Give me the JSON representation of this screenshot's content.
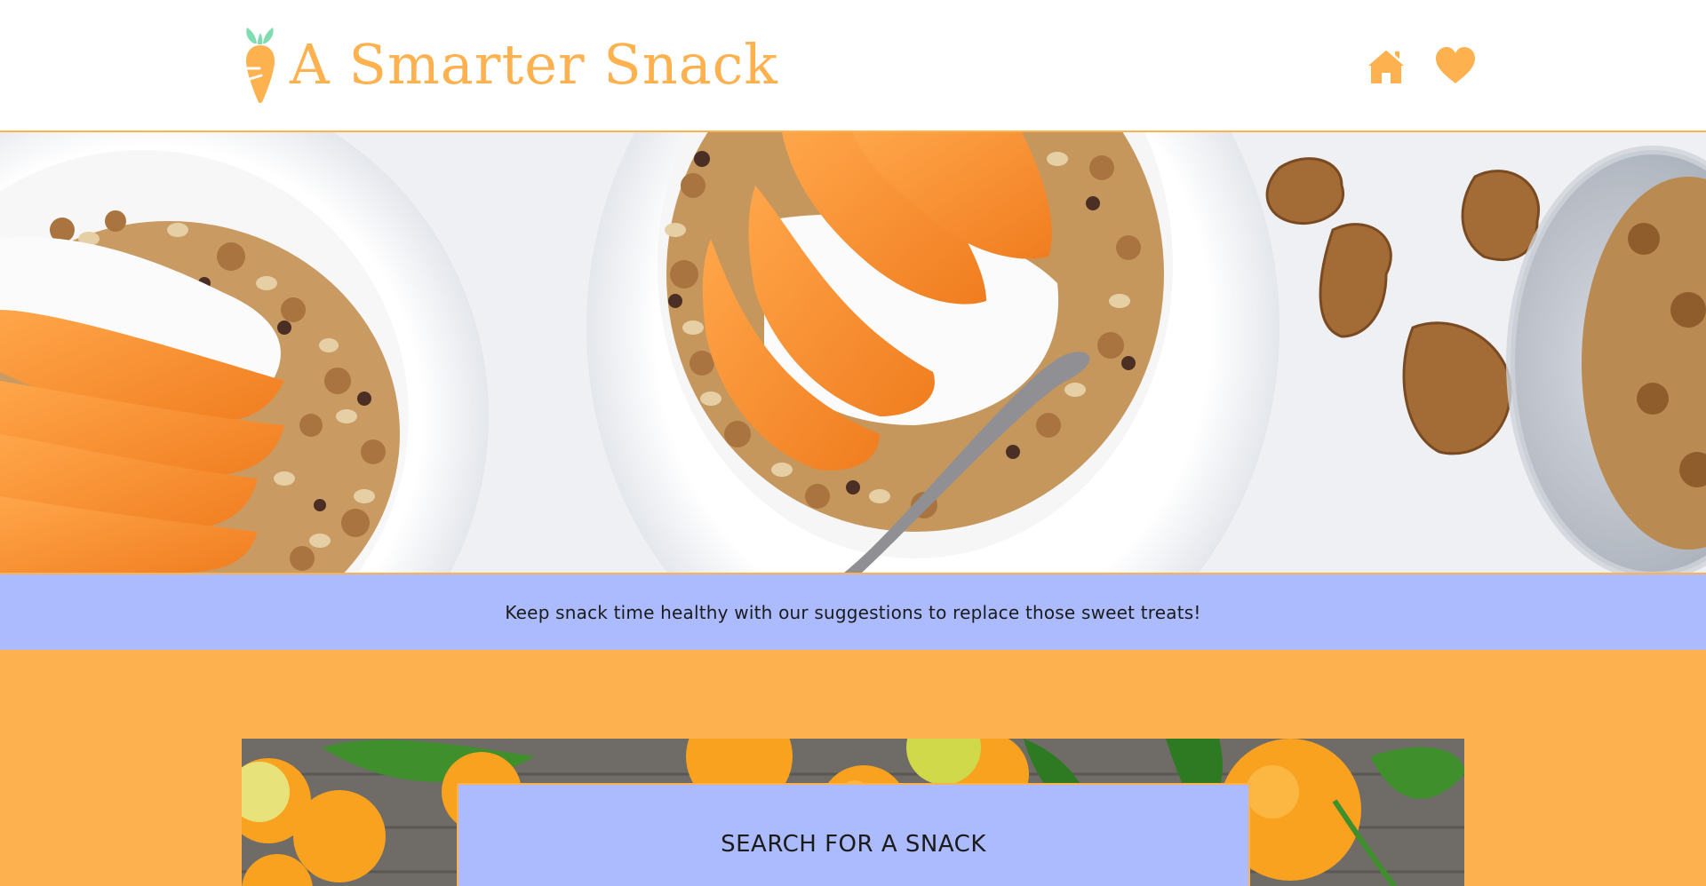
{
  "header": {
    "site_title": "A Smarter Snack",
    "logo_icon": "carrot-icon",
    "nav_icons": [
      "home-icon",
      "heart-icon"
    ]
  },
  "hero": {
    "image": "yogurt-granola-persimmon-bowls-with-walnuts"
  },
  "tagline": {
    "text": "Keep snack time healthy with our suggestions to replace those sweet treats!"
  },
  "search": {
    "title": "SEARCH FOR A SNACK",
    "background_image": "citrus-fruits-with-leaves"
  },
  "colors": {
    "brand_orange": "#fdb14f",
    "periwinkle": "#abbbfe",
    "leaf_green": "#7fdcb0",
    "text_dark": "#1b1b1b"
  }
}
